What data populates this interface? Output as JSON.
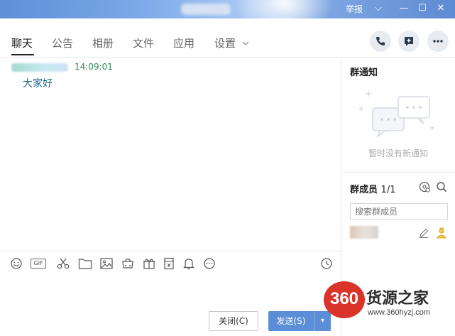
{
  "titlebar": {
    "report": "举报",
    "chevron": "⌵",
    "minimize": "—",
    "maximize": "☐",
    "close": "✕"
  },
  "tabs": [
    {
      "label": "聊天",
      "active": true
    },
    {
      "label": "公告"
    },
    {
      "label": "相册"
    },
    {
      "label": "文件"
    },
    {
      "label": "应用"
    },
    {
      "label": "设置"
    }
  ],
  "header_icons": [
    "phone-icon",
    "add-icon",
    "more-icon"
  ],
  "chat": {
    "messages": [
      {
        "time": "14:09:01",
        "text": "大家好"
      }
    ]
  },
  "toolbar": {
    "gif_label": "GIF",
    "icons": [
      "emoji-icon",
      "gif-icon",
      "scissors-icon",
      "folder-icon",
      "image-icon",
      "shop-icon",
      "gift-icon",
      "red-packet-icon",
      "bell-icon",
      "more-options-icon",
      "history-icon"
    ]
  },
  "actions": {
    "close_label": "关闭(C)",
    "send_label": "发送(S)",
    "send_arrow": "▾"
  },
  "sidebar": {
    "notice_title": "群通知",
    "notice_empty": "暂时没有新通知",
    "members_title": "群成员",
    "members_count": "1/1",
    "search_placeholder": "搜索群成员"
  },
  "watermark": {
    "logo": "360",
    "brand": "货源之家",
    "url": "www.360hyzj.com"
  },
  "colors": {
    "accent": "#5b8ed6",
    "time_green": "#2e8b57",
    "message_blue": "#1b6a8e",
    "watermark_red": "#d9332a"
  }
}
